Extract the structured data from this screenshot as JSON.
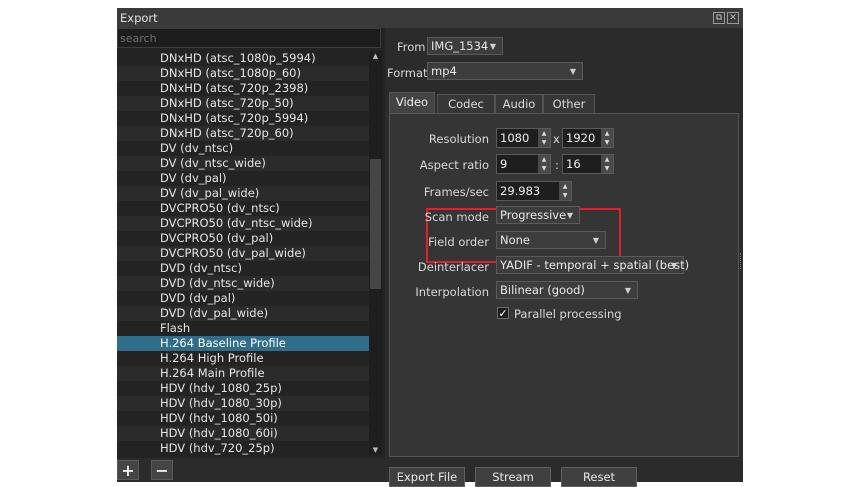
{
  "window": {
    "title": "Export"
  },
  "search": {
    "placeholder": "search"
  },
  "presets": [
    "DNxHD (atsc_1080p_5994)",
    "DNxHD (atsc_1080p_60)",
    "DNxHD (atsc_720p_2398)",
    "DNxHD (atsc_720p_50)",
    "DNxHD (atsc_720p_5994)",
    "DNxHD (atsc_720p_60)",
    "DV (dv_ntsc)",
    "DV (dv_ntsc_wide)",
    "DV (dv_pal)",
    "DV (dv_pal_wide)",
    "DVCPRO50 (dv_ntsc)",
    "DVCPRO50 (dv_ntsc_wide)",
    "DVCPRO50 (dv_pal)",
    "DVCPRO50 (dv_pal_wide)",
    "DVD (dv_ntsc)",
    "DVD (dv_ntsc_wide)",
    "DVD (dv_pal)",
    "DVD (dv_pal_wide)",
    "Flash",
    "H.264 Baseline Profile",
    "H.264 High Profile",
    "H.264 Main Profile",
    "HDV (hdv_1080_25p)",
    "HDV (hdv_1080_30p)",
    "HDV (hdv_1080_50i)",
    "HDV (hdv_1080_60i)",
    "HDV (hdv_720_25p)"
  ],
  "selected_preset": "H.264 Baseline Profile",
  "list_buttons": {
    "add": "+",
    "remove": "−"
  },
  "from": {
    "label": "From",
    "value": "IMG_1534"
  },
  "format": {
    "label": "Format",
    "value": "mp4"
  },
  "tabs": [
    "Video",
    "Codec",
    "Audio",
    "Other"
  ],
  "active_tab": "Video",
  "video": {
    "resolution": {
      "label": "Resolution",
      "width": "1080",
      "separator": "x",
      "height": "1920"
    },
    "aspect_ratio": {
      "label": "Aspect ratio",
      "num": "9",
      "separator": ":",
      "den": "16"
    },
    "frames_per_sec": {
      "label": "Frames/sec",
      "value": "29.983"
    },
    "scan_mode": {
      "label": "Scan mode",
      "value": "Progressive"
    },
    "field_order": {
      "label": "Field order",
      "value": "None"
    },
    "deinterlacer": {
      "label": "Deinterlacer",
      "value": "YADIF - temporal + spatial (best)"
    },
    "interpolation": {
      "label": "Interpolation",
      "value": "Bilinear (good)"
    },
    "parallel": {
      "label": "Parallel processing",
      "checked": true,
      "check_glyph": "✓"
    }
  },
  "actions": {
    "export": "Export File",
    "stream": "Stream",
    "reset": "Reset"
  },
  "colors": {
    "highlight": "#e0202a",
    "selection": "#2f6d8a",
    "panel": "#2b2b2b"
  }
}
